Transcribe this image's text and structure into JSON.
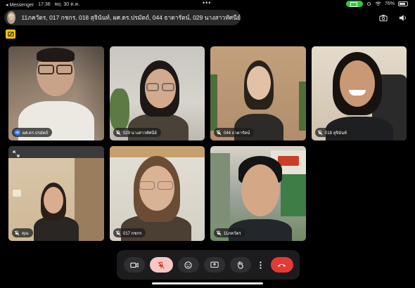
{
  "status_bar": {
    "back_app": "◂ Messenger",
    "time": "17:36",
    "date": "พฤ. 30 ต.ค.",
    "wifi_label": "wifi",
    "battery": "76%",
    "battery_level": 0.76
  },
  "header": {
    "title": "11ภควัตร, 017 กชกร, 018 สุจินันท์, ผศ.ดร.ปรมัตถ์, 044 ธาดารัตน์, 029 นางสาวทัศนีย์"
  },
  "participants": [
    {
      "name": "ผศ.ดร.ปรมัตถ์",
      "status": "speaking",
      "icon": "speaking-icon"
    },
    {
      "name": "029 นางสาวทัศนีย์",
      "status": "muted",
      "icon": "mic-muted-icon"
    },
    {
      "name": "044 ธาดารัตน์",
      "status": "muted",
      "icon": "mic-muted-icon"
    },
    {
      "name": "018 สุจินันท์",
      "status": "muted",
      "icon": "mic-muted-icon"
    },
    {
      "name": "คุณ",
      "status": "muted",
      "icon": "mic-muted-icon"
    },
    {
      "name": "017 กชกร",
      "status": "muted",
      "icon": "mic-muted-icon"
    },
    {
      "name": "11ภควัตร",
      "status": "muted",
      "icon": "mic-muted-icon"
    }
  ],
  "toolbar": {
    "buttons": [
      "camera-icon",
      "mic-muted-icon",
      "emoji-icon",
      "share-screen-icon",
      "raise-hand-icon",
      "more-icon",
      "end-call-icon"
    ]
  },
  "colors": {
    "background": "#000000",
    "accent_speaking": "#3b6fe0",
    "mic_button": "#f6c7c2",
    "end_call": "#e53935",
    "badge_yellow": "#f5c400"
  }
}
